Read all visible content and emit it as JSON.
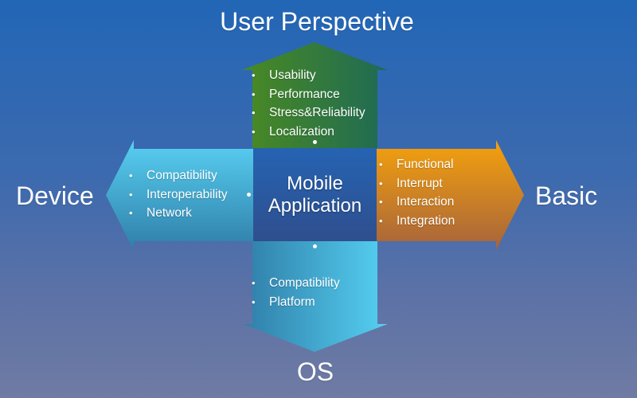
{
  "diagram": {
    "center": {
      "line1": "Mobile",
      "line2": "Application",
      "color": "#2a59a4"
    },
    "arrows": {
      "top": {
        "label": "User Perspective",
        "color_from": "#4a8a22",
        "color_to": "#1e6a55",
        "items": [
          "Usability",
          "Performance",
          "Stress&Reliability",
          "Localization"
        ]
      },
      "left": {
        "label": "Device",
        "color_from": "#58d0f2",
        "color_to": "#2f7ea8",
        "items": [
          "Compatibility",
          "Interoperability",
          "Network"
        ]
      },
      "right": {
        "label": "Basic",
        "color_from": "#f2a00f",
        "color_to": "#a9653a",
        "items": [
          "Functional",
          "Interrupt",
          "Interaction",
          "Integration"
        ]
      },
      "bottom": {
        "label": "OS",
        "color_from": "#2f7ea8",
        "color_to": "#55d0f2",
        "items": [
          "Compatibility",
          "Platform"
        ]
      }
    }
  }
}
